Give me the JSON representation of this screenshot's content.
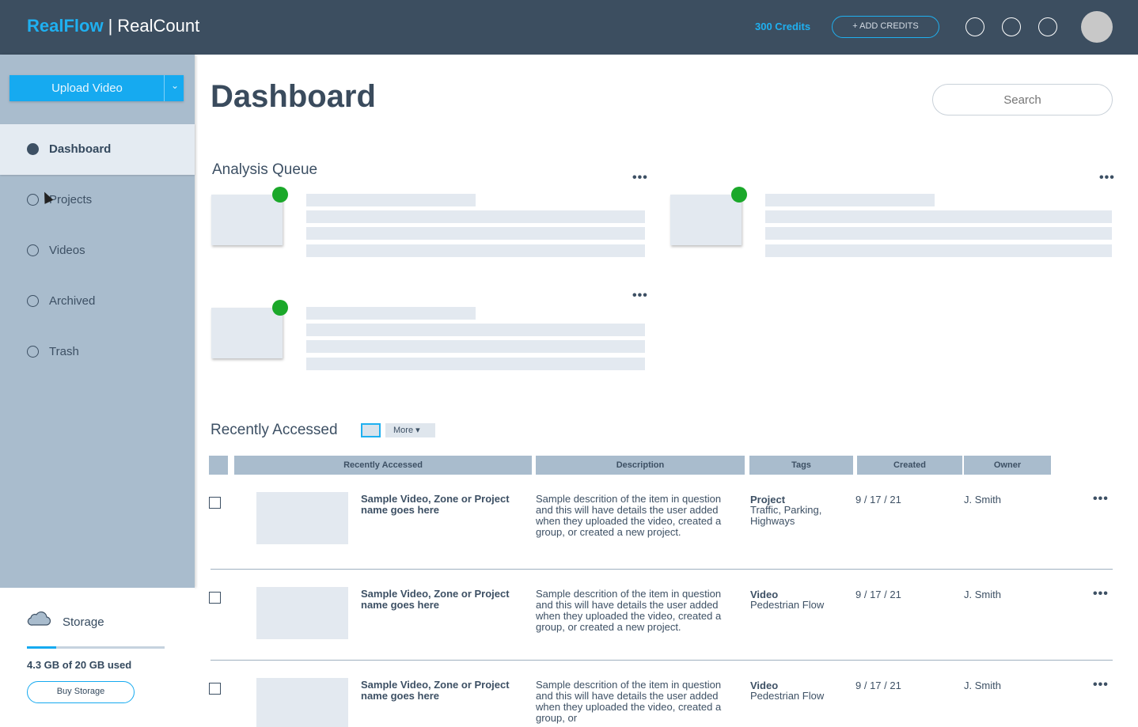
{
  "header": {
    "brand_primary": "RealFlow",
    "brand_separator": "|",
    "brand_secondary": "RealCount",
    "credits": "300 Credits",
    "add_credits_label": "+ ADD CREDITS",
    "icons": [
      "header-icon-1",
      "header-icon-2",
      "header-icon-3"
    ],
    "accent_color": "#1fb0f0"
  },
  "sidebar": {
    "upload_label": "Upload Video",
    "items": [
      {
        "label": "Dashboard",
        "active": true
      },
      {
        "label": "Projects",
        "active": false
      },
      {
        "label": "Videos",
        "active": false
      },
      {
        "label": "Archived",
        "active": false
      },
      {
        "label": "Trash",
        "active": false
      }
    ],
    "storage": {
      "label": "Storage",
      "used_text": "4.3 GB of 20 GB used",
      "used_fraction": 0.215,
      "buy_label": "Buy Storage"
    }
  },
  "main": {
    "title": "Dashboard",
    "search_placeholder": "Search",
    "analysis_queue": {
      "title": "Analysis Queue",
      "more_label": "•••",
      "status_color": "#1ba82a"
    },
    "recent": {
      "title": "Recently Accessed",
      "more_label": "More ▾",
      "columns": [
        "Recently Accessed",
        "Description",
        "Tags",
        "Created",
        "Owner"
      ],
      "rows": [
        {
          "name": "Sample Video, Zone or Project name goes here",
          "description": "Sample descrition of the item in question and this will have details the user added when they uploaded the video, created a group, or created a new project.",
          "tag_type": "Project",
          "tags": "Traffic, Parking, Highways",
          "created": "9 / 17 / 21",
          "owner": "J. Smith"
        },
        {
          "name": "Sample Video, Zone or Project name goes here",
          "description": "Sample descrition of the item in question and this will have details the user added when they uploaded the video, created a group, or created a new project.",
          "tag_type": "Video",
          "tags": "Pedestrian Flow",
          "created": "9 / 17 / 21",
          "owner": "J. Smith"
        },
        {
          "name": "Sample Video, Zone or Project name goes here",
          "description": "Sample descrition of the item in question and this will have details the user added when they uploaded the video, created a group, or",
          "tag_type": "Video",
          "tags": "Pedestrian Flow",
          "created": "9 / 17 / 21",
          "owner": "J. Smith"
        }
      ],
      "row_more_label": "•••"
    }
  }
}
